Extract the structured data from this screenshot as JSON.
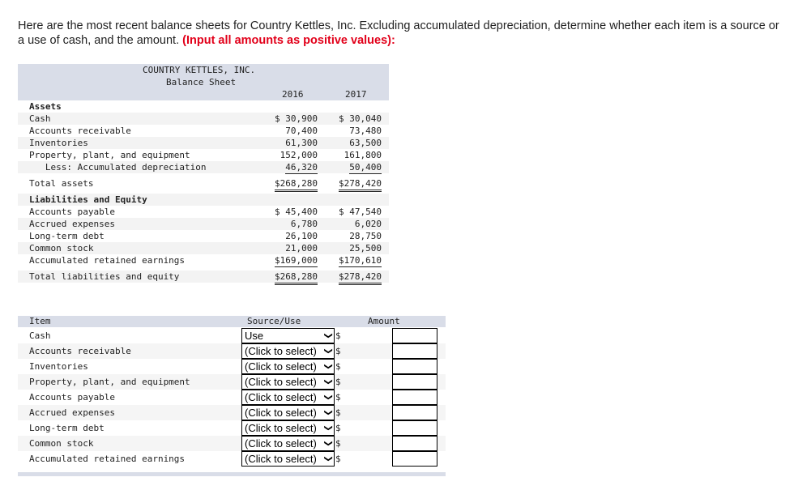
{
  "intro": {
    "text": "Here are the most recent balance sheets for Country Kettles, Inc. Excluding accumulated depreciation, determine whether each item is a source or a use of cash, and the amount. ",
    "emphasis": "(Input all amounts as positive values):"
  },
  "balance_sheet": {
    "company": "COUNTRY KETTLES, INC.",
    "title": "Balance Sheet",
    "years": [
      "2016",
      "2017"
    ],
    "rows": [
      {
        "label": "Assets",
        "v1": "",
        "v2": "",
        "bold": true
      },
      {
        "label": "Cash",
        "v1": "$ 30,900",
        "v2": "$ 30,040"
      },
      {
        "label": "Accounts receivable",
        "v1": "70,400",
        "v2": "73,480"
      },
      {
        "label": "Inventories",
        "v1": "61,300",
        "v2": "63,500"
      },
      {
        "label": "Property, plant, and equipment",
        "v1": "152,000",
        "v2": "161,800"
      },
      {
        "label": "   Less: Accumulated depreciation",
        "v1": "46,320",
        "v2": "50,400",
        "ul": true
      },
      {
        "label": "Total assets",
        "v1": "$268,280",
        "v2": "$278,420",
        "dul": true
      },
      {
        "label": "Liabilities and Equity",
        "v1": "",
        "v2": "",
        "bold": true
      },
      {
        "label": "Accounts payable",
        "v1": "$ 45,400",
        "v2": "$ 47,540"
      },
      {
        "label": "Accrued expenses",
        "v1": "6,780",
        "v2": "6,020"
      },
      {
        "label": "Long-term debt",
        "v1": "26,100",
        "v2": "28,750"
      },
      {
        "label": "Common stock",
        "v1": "21,000",
        "v2": "25,500"
      },
      {
        "label": "Accumulated retained earnings",
        "v1": "$169,000",
        "v2": "$170,610",
        "ul": true
      },
      {
        "label": "Total liabilities and equity",
        "v1": "$268,280",
        "v2": "$278,420",
        "dul": true
      }
    ]
  },
  "answer_table": {
    "headers": {
      "item": "Item",
      "source_use": "Source/Use",
      "amount": "Amount"
    },
    "currency": "$",
    "rows": [
      {
        "item": "Cash",
        "selected": "Use",
        "amount": ""
      },
      {
        "item": "Accounts receivable",
        "selected": "(Click to select)",
        "amount": ""
      },
      {
        "item": "Inventories",
        "selected": "(Click to select)",
        "amount": ""
      },
      {
        "item": "Property, plant, and equipment",
        "selected": "(Click to select)",
        "amount": ""
      },
      {
        "item": "Accounts payable",
        "selected": "(Click to select)",
        "amount": ""
      },
      {
        "item": "Accrued expenses",
        "selected": "(Click to select)",
        "amount": ""
      },
      {
        "item": "Long-term debt",
        "selected": "(Click to select)",
        "amount": ""
      },
      {
        "item": "Common stock",
        "selected": "(Click to select)",
        "amount": ""
      },
      {
        "item": "Accumulated retained earnings",
        "selected": "(Click to select)",
        "amount": ""
      }
    ]
  },
  "colors": {
    "header_bg": "#d9dde8",
    "emphasis": "#e2001a"
  }
}
